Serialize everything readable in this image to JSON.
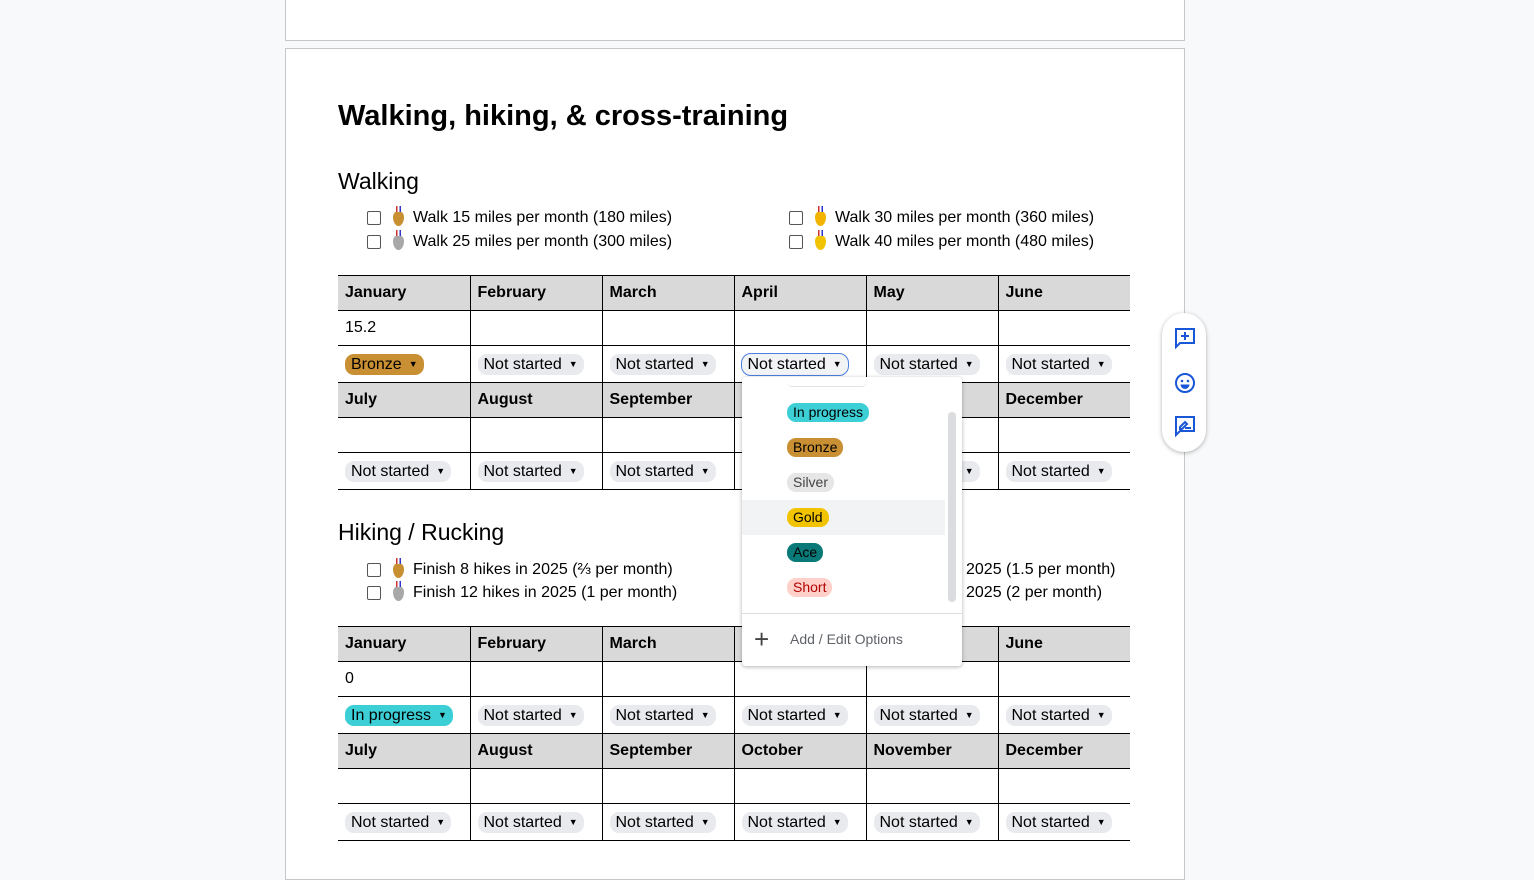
{
  "title": "Walking, hiking, & cross-training",
  "colors": {
    "bronze": "#c98f33",
    "in_progress": "#3dcfd6",
    "silver": "#e6e6e6",
    "gold": "#f2c300",
    "ace": "#0a7a78",
    "short": "#ffcfc9",
    "short_text": "#b10202",
    "not_started": "#e8eaed",
    "icon_blue": "#1a57d6"
  },
  "walking": {
    "heading": "Walking",
    "goals": [
      {
        "label": "Walk 15 miles per month (180 miles)",
        "medal": "bronze",
        "checked": false
      },
      {
        "label": "Walk 25 miles per month (300 miles)",
        "medal": "silver",
        "checked": false
      },
      {
        "label": "Walk 30 miles per month (360 miles)",
        "medal": "gold",
        "checked": false
      },
      {
        "label": "Walk 40 miles per month (480 miles)",
        "medal": "gold-sports",
        "checked": false
      }
    ],
    "row1": {
      "months": [
        "January",
        "February",
        "March",
        "April",
        "May",
        "June"
      ],
      "values": [
        "15.2",
        "",
        "",
        "",
        "",
        ""
      ],
      "status": [
        "Bronze",
        "Not started",
        "Not started",
        "Not started",
        "Not started",
        "Not started"
      ]
    },
    "row2": {
      "months": [
        "July",
        "August",
        "September",
        "",
        "",
        "December"
      ],
      "values": [
        "",
        "",
        "",
        "",
        "",
        ""
      ],
      "status": [
        "Not started",
        "Not started",
        "Not started",
        "",
        "Not started",
        "Not started"
      ]
    }
  },
  "hiking": {
    "heading": "Hiking / Rucking",
    "goals": [
      {
        "label": "Finish 8 hikes in 2025 (⅔ per month)",
        "medal": "bronze",
        "checked": false
      },
      {
        "label": "Finish 12 hikes in 2025 (1 per month)",
        "medal": "silver",
        "checked": false
      },
      {
        "label": "2025 (1.5 per month)"
      },
      {
        "label": "2025 (2 per month)"
      }
    ],
    "row1": {
      "months": [
        "January",
        "February",
        "March",
        "",
        "",
        "June"
      ],
      "values": [
        "0",
        "",
        "",
        "",
        "",
        ""
      ],
      "status": [
        "In progress",
        "Not started",
        "Not started",
        "Not started",
        "Not started",
        "Not started"
      ]
    },
    "row2": {
      "months": [
        "July",
        "August",
        "September",
        "October",
        "November",
        "December"
      ],
      "values": [
        "",
        "",
        "",
        "",
        "",
        ""
      ],
      "status": [
        "Not started",
        "Not started",
        "Not started",
        "Not started",
        "Not started",
        "Not started"
      ]
    }
  },
  "dropdown": {
    "options": [
      "In progress",
      "Bronze",
      "Silver",
      "Gold",
      "Ace",
      "Short"
    ],
    "highlighted": "Gold",
    "add_label": "Add / Edit Options"
  },
  "side_toolbar": [
    "add-comment-icon",
    "emoji-reaction-icon",
    "suggest-edit-icon"
  ]
}
